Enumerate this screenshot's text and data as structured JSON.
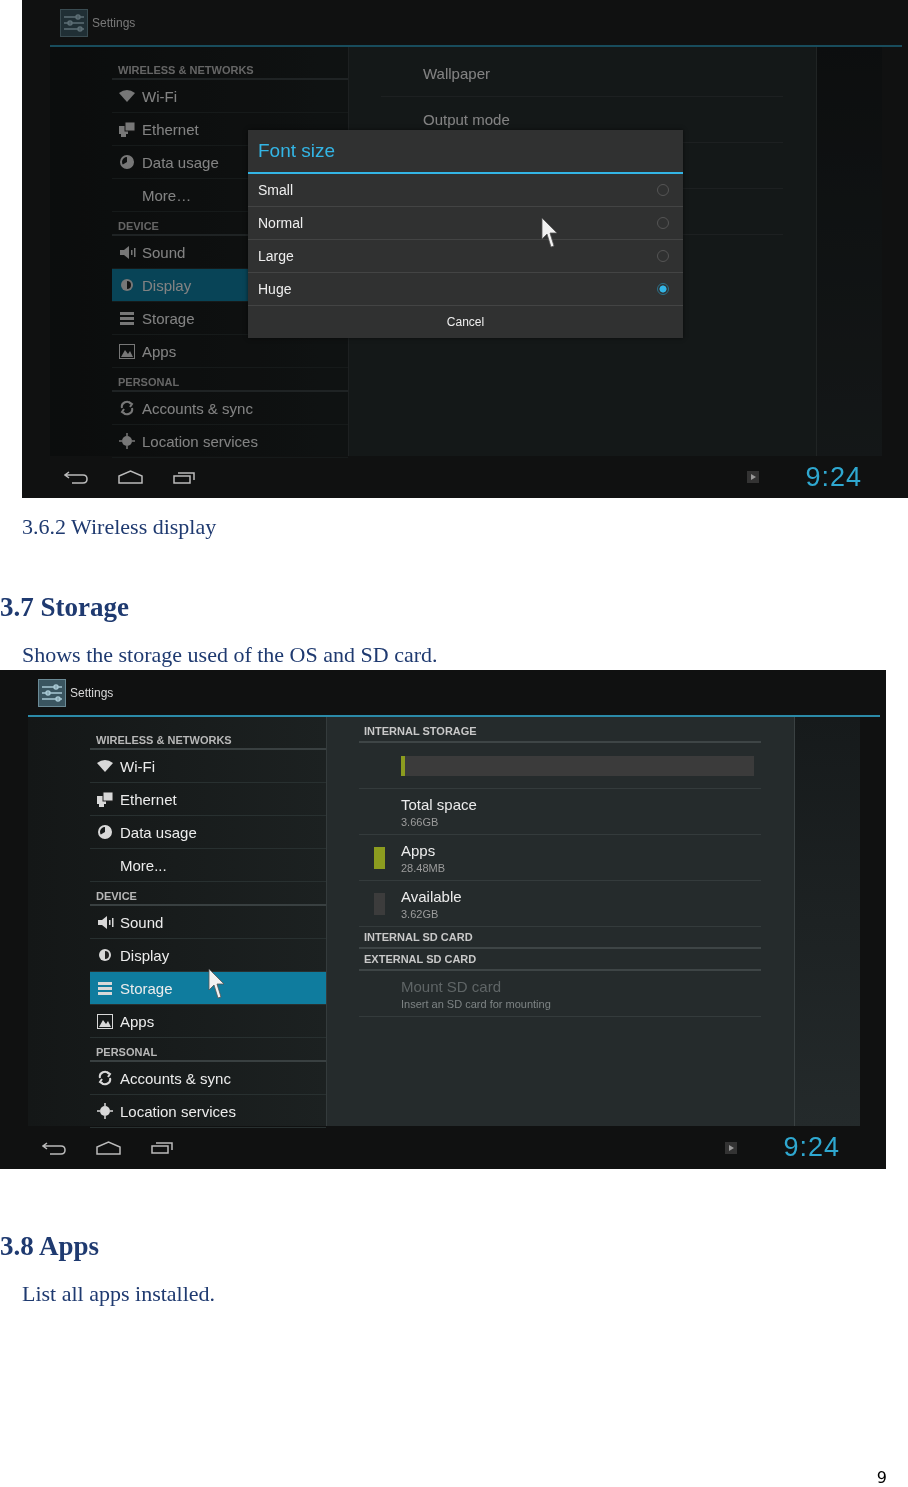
{
  "blocks": [
    {
      "kind": "screen",
      "title": "Settings",
      "clock": "9:24",
      "sections": [
        {
          "header": "WIRELESS & NETWORKS",
          "items": [
            {
              "label": "Wi-Fi",
              "selected": false
            },
            {
              "label": "Ethernet",
              "selected": false
            },
            {
              "label": "Data usage",
              "selected": false
            },
            {
              "label": "More…",
              "selected": false
            }
          ]
        },
        {
          "header": "DEVICE",
          "items": [
            {
              "label": "Sound",
              "selected": false
            },
            {
              "label": "Display",
              "selected": true
            },
            {
              "label": "Storage",
              "selected": false
            },
            {
              "label": "Apps",
              "selected": false
            }
          ]
        },
        {
          "header": "PERSONAL",
          "items": [
            {
              "label": "Accounts & sync",
              "selected": false
            },
            {
              "label": "Location services",
              "selected": false
            }
          ]
        }
      ],
      "detail": [
        {
          "kind": "item",
          "title": "Wallpaper",
          "disabled": false
        },
        {
          "kind": "item",
          "title": "Output mode",
          "disabled": false
        },
        {
          "kind": "blank"
        },
        {
          "kind": "blank"
        }
      ],
      "dialog": {
        "title": "Font size",
        "options": [
          {
            "label": "Small",
            "selected": false
          },
          {
            "label": "Normal",
            "selected": false
          },
          {
            "label": "Large",
            "selected": false
          },
          {
            "label": "Huge",
            "selected": true
          }
        ],
        "cancel": "Cancel"
      }
    },
    {
      "kind": "caption",
      "text": "3.6.2 Wireless display"
    },
    {
      "kind": "heading",
      "text": "3.7 Storage"
    },
    {
      "kind": "paragraph",
      "text": "Shows the storage used of the OS and SD card."
    },
    {
      "kind": "screen",
      "title": "Settings",
      "clock": "9:24",
      "sections": [
        {
          "header": "WIRELESS & NETWORKS",
          "items": [
            {
              "label": "Wi-Fi",
              "selected": false
            },
            {
              "label": "Ethernet",
              "selected": false
            },
            {
              "label": "Data usage",
              "selected": false
            },
            {
              "label": "More...",
              "selected": false
            }
          ]
        },
        {
          "header": "DEVICE",
          "items": [
            {
              "label": "Sound",
              "selected": false
            },
            {
              "label": "Display",
              "selected": false
            },
            {
              "label": "Storage",
              "selected": true
            },
            {
              "label": "Apps",
              "selected": false
            }
          ]
        },
        {
          "header": "PERSONAL",
          "items": [
            {
              "label": "Accounts & sync",
              "selected": false
            },
            {
              "label": "Location services",
              "selected": false
            }
          ]
        }
      ],
      "detail": [
        {
          "kind": "header",
          "title": "INTERNAL STORAGE"
        },
        {
          "kind": "bar",
          "level": 0.01
        },
        {
          "kind": "item",
          "title": "Total space",
          "subtitle": "3.66GB",
          "disabled": false
        },
        {
          "kind": "item",
          "title": "Apps",
          "subtitle": "28.48MB",
          "color": "#8c9c1f",
          "disabled": false
        },
        {
          "kind": "item",
          "title": "Available",
          "subtitle": "3.62GB",
          "color": "#3c3c3c",
          "disabled": false
        },
        {
          "kind": "header",
          "title": "INTERNAL SD CARD"
        },
        {
          "kind": "header",
          "title": "EXTERNAL SD CARD"
        },
        {
          "kind": "item",
          "title": "Mount SD card",
          "subtitle": "Insert an SD card for mounting",
          "disabled": true
        }
      ]
    },
    {
      "kind": "heading",
      "text": "3.8 Apps"
    },
    {
      "kind": "paragraph",
      "text": "List all apps installed."
    }
  ],
  "page_number": "9"
}
